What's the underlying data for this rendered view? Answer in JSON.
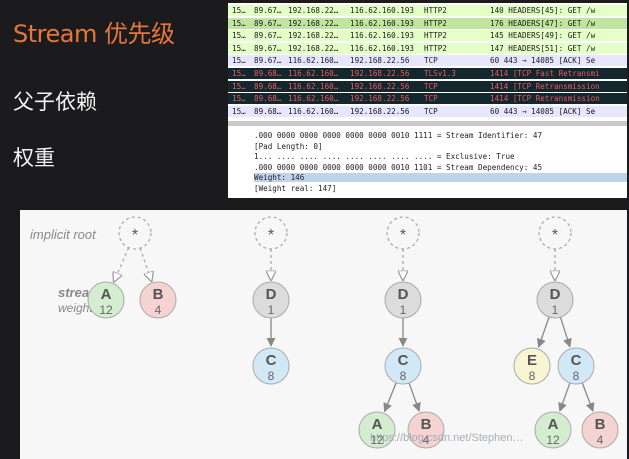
{
  "slide": {
    "title": "Stream 优先级",
    "bullets": [
      "父子依赖",
      "权重"
    ]
  },
  "packets": [
    {
      "no": "15…",
      "time": "89.67…",
      "src": "192.168.22…",
      "dst": "116.62.160.193",
      "proto": "HTTP2",
      "info": "140 HEADERS[45]: GET /w",
      "bg": "#e4ffc7"
    },
    {
      "no": "15…",
      "time": "89.67…",
      "src": "192.168.22…",
      "dst": "116.62.160.193",
      "proto": "HTTP2",
      "info": "176 HEADERS[47]: GET /w",
      "bg": "#bfe59f"
    },
    {
      "no": "15…",
      "time": "89.67…",
      "src": "192.168.22…",
      "dst": "116.62.160.193",
      "proto": "HTTP2",
      "info": "145 HEADERS[49]: GET /w",
      "bg": "#e4ffc7"
    },
    {
      "no": "15…",
      "time": "89.67…",
      "src": "192.168.22…",
      "dst": "116.62.160.193",
      "proto": "HTTP2",
      "info": "147 HEADERS[51]: GET /w",
      "bg": "#e4ffc7"
    },
    {
      "no": "15…",
      "time": "89.67…",
      "src": "116.62.160…",
      "dst": "192.168.22.56",
      "proto": "TCP",
      "info": "60 443 → 14085 [ACK] Se",
      "bg": "#e7e6ff"
    },
    {
      "no": "15…",
      "time": "89.68…",
      "src": "116.62.160…",
      "dst": "192.168.22.56",
      "proto": "TLSv1.3",
      "info": "1414 [TCP Fast Retransmi",
      "bg": "#12272e"
    },
    {
      "no": "15…",
      "time": "89.68…",
      "src": "116.62.160…",
      "dst": "192.168.22.56",
      "proto": "TCP",
      "info": "1414 [TCP Retransmission",
      "bg": "#12272e"
    },
    {
      "no": "15…",
      "time": "89.68…",
      "src": "116.62.160…",
      "dst": "192.168.22.56",
      "proto": "TCP",
      "info": "1414 [TCP Retransmission",
      "bg": "#12272e"
    },
    {
      "no": "15…",
      "time": "89.68…",
      "src": "116.62.160…",
      "dst": "192.168.22.56",
      "proto": "TCP",
      "info": "60 443 → 14085 [ACK] Se",
      "bg": "#e7e6ff"
    }
  ],
  "details": [
    ".000 0000 0000 0000 0000 0000 0010 1111 = Stream Identifier: 47",
    "[Pad Length: 0]",
    "1... .... .... .... .... .... .... .... = Exclusive: True",
    ".000 0000 0000 0000 0000 0000 0010 1101 = Stream Dependency: 45",
    "Weight: 146",
    "[Weight real: 147]"
  ],
  "details_highlight_index": 4,
  "diagram": {
    "labels": {
      "implicit_root": "implicit root",
      "stream": "stream",
      "weight": "weight"
    },
    "root_label": "*",
    "colors": {
      "A": "#d4edd0",
      "B": "#f6d3d3",
      "C": "#d1e8f6",
      "D": "#dcdcdc",
      "E": "#f8f5d2"
    },
    "groups": [
      {
        "nodes": [
          {
            "id": "A",
            "weight": "12"
          },
          {
            "id": "B",
            "weight": "4"
          }
        ]
      },
      {
        "nodes": [
          {
            "id": "D",
            "weight": "1"
          },
          {
            "id": "C",
            "weight": "8"
          }
        ]
      },
      {
        "nodes": [
          {
            "id": "D",
            "weight": "1"
          },
          {
            "id": "C",
            "weight": "8"
          },
          {
            "id": "A",
            "weight": "12"
          },
          {
            "id": "B",
            "weight": "4"
          }
        ]
      },
      {
        "nodes": [
          {
            "id": "D",
            "weight": "1"
          },
          {
            "id": "E",
            "weight": "8"
          },
          {
            "id": "C",
            "weight": "8"
          },
          {
            "id": "A",
            "weight": "12"
          },
          {
            "id": "B",
            "weight": "4"
          }
        ]
      }
    ]
  },
  "watermark": "https://blog.csdn.net/Stephen…"
}
